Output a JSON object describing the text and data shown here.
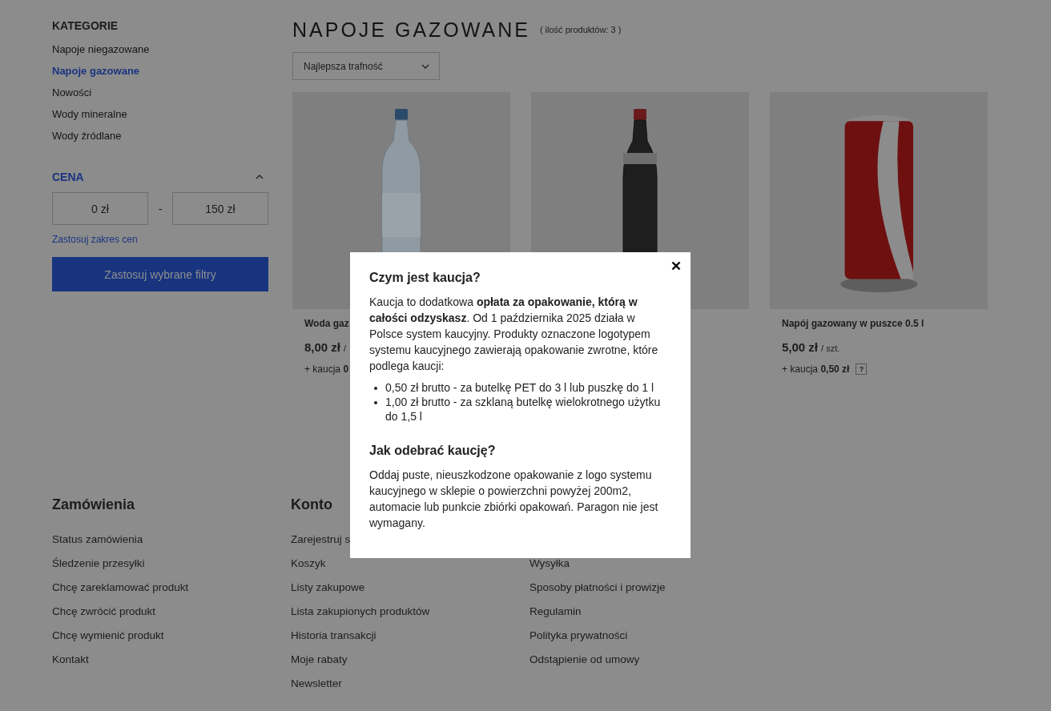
{
  "sidebar": {
    "categories_title": "KATEGORIE",
    "categories": [
      {
        "label": "Napoje niegazowane",
        "selected": false
      },
      {
        "label": "Napoje gazowane",
        "selected": true
      },
      {
        "label": "Nowości",
        "selected": false
      },
      {
        "label": "Wody mineralne",
        "selected": false
      },
      {
        "label": "Wody źródlane",
        "selected": false
      }
    ],
    "price": {
      "title": "CENA",
      "expanded": true,
      "min": "0 zł",
      "separator": "-",
      "max": "150 zł",
      "apply_link": "Zastosuj zakres cen"
    },
    "apply_button": "Zastosuj wybrane filtry"
  },
  "main": {
    "title": "NAPOJE GAZOWANE",
    "count": "( ilość produktów: 3 )",
    "sort": {
      "value": "Najlepsza trafność"
    },
    "products": [
      {
        "kind": "clear-bottle",
        "name": "Woda gaz",
        "price": "8,00 zł",
        "unit": "/",
        "deposit": "+ kaucja **0**"
      },
      {
        "kind": "dark-bottle"
      },
      {
        "kind": "can",
        "name": "Napój gazowany w puszce 0.5 l",
        "price": "5,00 zł",
        "unit": "/ szt.",
        "deposit": "+ kaucja **0,50 zł**",
        "help": "?"
      }
    ]
  },
  "footer": {
    "columns": [
      {
        "title": "Zamówienia",
        "links": [
          "Status zamówienia",
          "Śledzenie przesyłki",
          "Chcę zareklamować produkt",
          "Chcę zwrócić produkt",
          "Chcę wymienić produkt",
          "Kontakt"
        ]
      },
      {
        "title": "Konto",
        "links": [
          "Zarejestruj s",
          "Koszyk",
          "Listy zakupowe",
          "Lista zakupionych produktów",
          "Historia transakcji",
          "Moje rabaty",
          "Newsletter"
        ]
      },
      {
        "links": [
          "Wysyłka",
          "Sposoby płatności i prowizje",
          "Regulamin",
          "Polityka prywatności",
          "Odstąpienie od umowy"
        ]
      }
    ]
  },
  "modal": {
    "sections": [
      {
        "title": "Czym jest kaucja?",
        "text": "Kaucja to dodatkowa **opłata za opakowanie, którą w całości odzyskasz**. Od 1 października 2025 działa w Polsce system kaucyjny. Produkty oznaczone logotypem systemu kaucyjnego zawierają opakowanie zwrotne, które podlega kaucji:",
        "items": [
          "0,50 zł brutto - za butelkę PET do 3 l lub puszkę do 1 l",
          "1,00 zł brutto - za szklaną butelkę wielokrotnego użytku do 1,5 l"
        ]
      },
      {
        "title": "Jak odebrać kaucję?",
        "text": "Oddaj puste, nieuszkodzone opakowanie z logo systemu kaucyjnego w sklepie o powierzchni powyżej 200m2, automacie lub punkcie zbiórki opakowań. Paragon nie jest wymagany."
      }
    ]
  }
}
